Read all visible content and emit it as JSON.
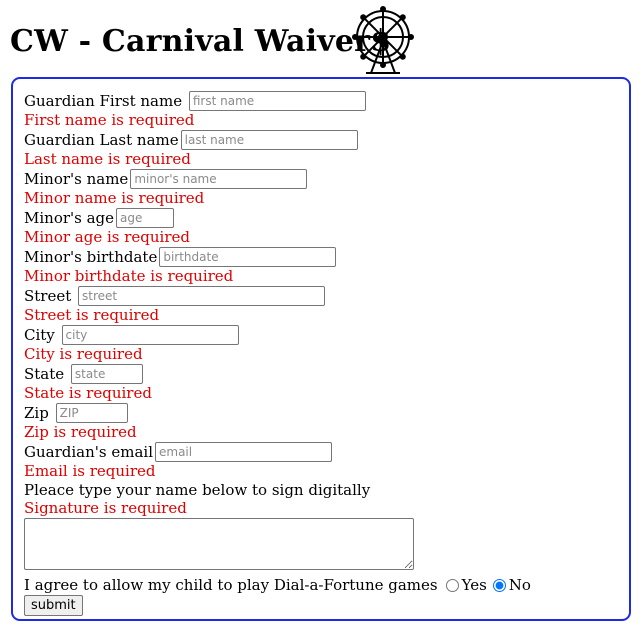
{
  "title": "CW - Carnival Waiver$",
  "form": {
    "fields": [
      {
        "label": "Guardian First name ",
        "placeholder": "first name",
        "error": "First name is required"
      },
      {
        "label": "Guardian Last name",
        "placeholder": "last name",
        "error": "Last name is required"
      },
      {
        "label": "Minor's name",
        "placeholder": "minor's name",
        "error": "Minor name is required"
      },
      {
        "label": "Minor's age",
        "placeholder": "age",
        "error": "Minor age is required"
      },
      {
        "label": "Minor's birthdate",
        "placeholder": "birthdate",
        "error": "Minor birthdate is required"
      },
      {
        "label": "Street ",
        "placeholder": "street",
        "error": "Street is required"
      },
      {
        "label": "City ",
        "placeholder": "city",
        "error": "City is required"
      },
      {
        "label": "State ",
        "placeholder": "state",
        "error": "State is required"
      },
      {
        "label": "Zip ",
        "placeholder": "ZIP",
        "error": "Zip is required"
      },
      {
        "label": "Guardian's email",
        "placeholder": "email",
        "error": "Email is required"
      }
    ],
    "signature_prompt": "Pleace type your name below to sign digitally",
    "signature_error": "Signature is required",
    "agree_text": "I agree to allow my child to play Dial-a-Fortune games",
    "yes_label": "Yes",
    "no_label": "No",
    "selected": "No",
    "submit_label": "submit"
  }
}
